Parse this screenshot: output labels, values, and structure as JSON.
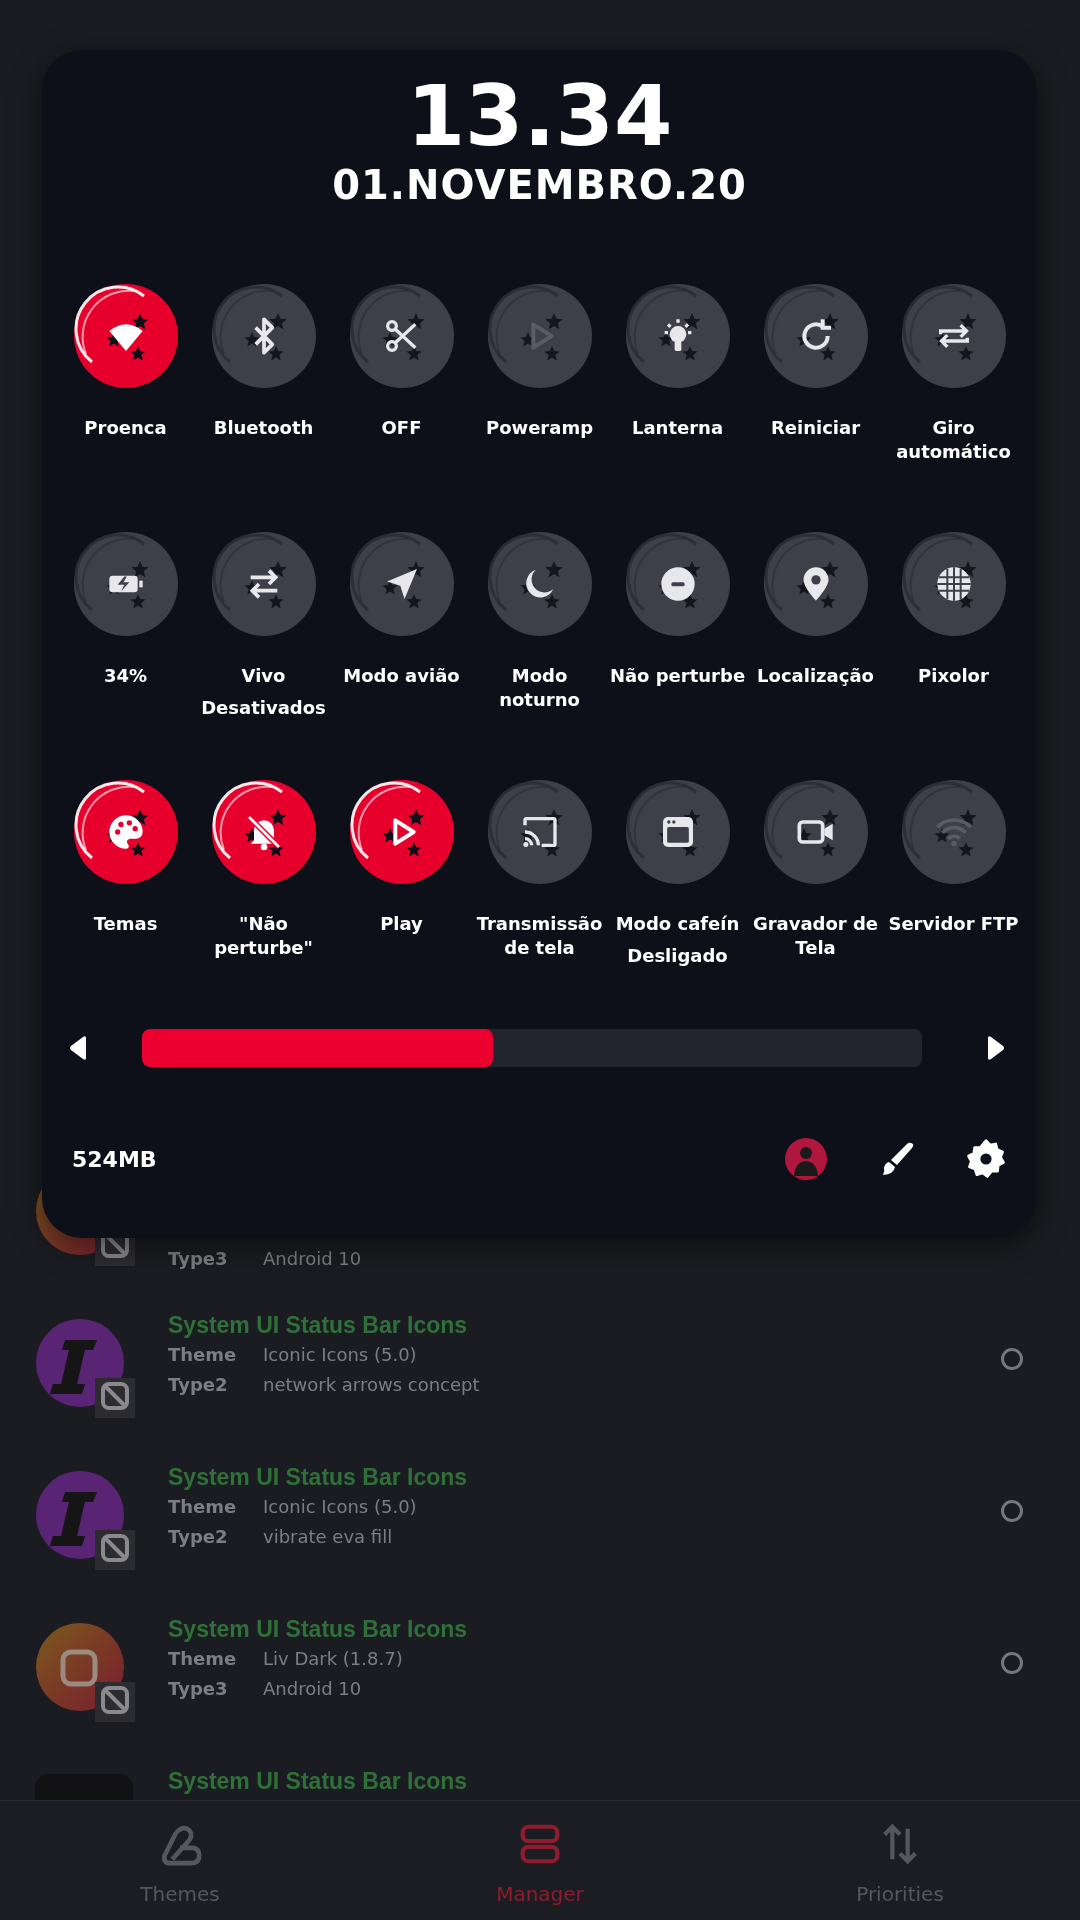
{
  "panel": {
    "time": "13.34",
    "date": "01.NOVEMBRO.20",
    "tiles": [
      {
        "label": "Proenca",
        "on": true,
        "available": true
      },
      {
        "label": "Bluetooth",
        "on": false,
        "available": true
      },
      {
        "label": "OFF",
        "on": false,
        "available": true
      },
      {
        "label": "Poweramp",
        "on": false,
        "available": false
      },
      {
        "label": "Lanterna",
        "on": false,
        "available": true
      },
      {
        "label": "Reiniciar",
        "on": false,
        "available": true
      },
      {
        "label": "Giro automático",
        "on": false,
        "available": true
      },
      {
        "label": "34%",
        "on": false,
        "available": true
      },
      {
        "label": "Vivo",
        "sublabel": "Desativados",
        "on": false,
        "available": true
      },
      {
        "label": "Modo avião",
        "on": false,
        "available": true
      },
      {
        "label": "Modo noturno",
        "on": false,
        "available": true
      },
      {
        "label": "Não perturbe",
        "on": false,
        "available": true
      },
      {
        "label": "Localização",
        "on": false,
        "available": true
      },
      {
        "label": "Pixolor",
        "on": false,
        "available": true
      },
      {
        "label": "Temas",
        "on": true,
        "available": true
      },
      {
        "label": "\"Não perturbe\"",
        "on": true,
        "available": true
      },
      {
        "label": "Play",
        "on": true,
        "available": true
      },
      {
        "label": "Transmissão de tela",
        "on": false,
        "available": true
      },
      {
        "label": "Modo cafeín",
        "sublabel": "Desligado",
        "on": false,
        "available": true
      },
      {
        "label": "Gravador de Tela",
        "on": false,
        "available": true
      },
      {
        "label": "Servidor FTP",
        "on": false,
        "available": false
      }
    ],
    "slider": {
      "level": 0.45
    },
    "memory": "524MB"
  },
  "list": {
    "rows": [
      {
        "kind": "liv",
        "type_label": "Type3",
        "type_value": "Android 10"
      },
      {
        "kind": "iconic",
        "title": "System UI Status Bar Icons",
        "theme_label": "Theme",
        "theme_value": "Iconic Icons (5.0)",
        "type_label": "Type2",
        "type_value": "network arrows concept",
        "selected": false
      },
      {
        "kind": "iconic",
        "title": "System UI Status Bar Icons",
        "theme_label": "Theme",
        "theme_value": "Iconic Icons (5.0)",
        "type_label": "Type2",
        "type_value": "vibrate eva fill",
        "selected": false
      },
      {
        "kind": "liv",
        "title": "System UI Status Bar Icons",
        "theme_label": "Theme",
        "theme_value": "Liv Dark (1.8.7)",
        "type_label": "Type3",
        "type_value": "Android 10",
        "selected": false
      },
      {
        "kind": "dark",
        "title": "System UI Status Bar Icons"
      }
    ]
  },
  "nav": [
    {
      "label": "Themes",
      "selected": false
    },
    {
      "label": "Manager",
      "selected": true
    },
    {
      "label": "Priorities",
      "selected": false
    }
  ]
}
